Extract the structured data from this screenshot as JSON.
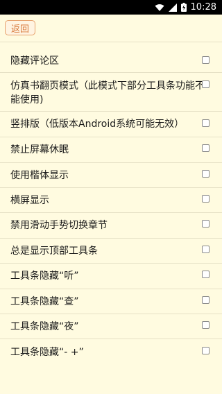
{
  "status_bar": {
    "time": "10:28",
    "icons": [
      "wifi-icon",
      "signal-icon",
      "battery-icon"
    ]
  },
  "toolbar": {
    "back_label": "返回",
    "accent_color": "#d8783a"
  },
  "settings": [
    {
      "label": "隐藏评论区",
      "checked": false
    },
    {
      "label": "仿真书翻页模式（此模式下部分工具条功能不能使用)",
      "checked": false
    },
    {
      "label": "竖排版（低版本Android系统可能无效）",
      "checked": false
    },
    {
      "label": "禁止屏幕休眠",
      "checked": false
    },
    {
      "label": "使用楷体显示",
      "checked": false
    },
    {
      "label": "横屏显示",
      "checked": false
    },
    {
      "label": "禁用滑动手势切换章节",
      "checked": false
    },
    {
      "label": "总是显示顶部工具条",
      "checked": false
    },
    {
      "label": "工具条隐藏“听”",
      "checked": false
    },
    {
      "label": "工具条隐藏“查”",
      "checked": false
    },
    {
      "label": "工具条隐藏“夜”",
      "checked": false
    },
    {
      "label": "工具条隐藏“- +”",
      "checked": false
    }
  ]
}
